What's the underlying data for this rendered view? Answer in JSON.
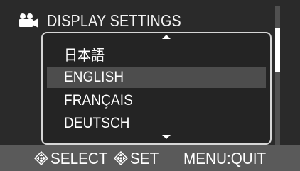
{
  "header": {
    "icon": "movie-camera-icon",
    "title": "DISPLAY SETTINGS"
  },
  "language_list": {
    "items": [
      {
        "label": "日本語",
        "selected": false
      },
      {
        "label": "ENGLISH",
        "selected": true
      },
      {
        "label": "FRANÇAIS",
        "selected": false
      },
      {
        "label": "DEUTSCH",
        "selected": false
      }
    ],
    "up_arrow_icon": "triangle-up-icon",
    "down_arrow_icon": "triangle-down-icon"
  },
  "footer": {
    "select_icon": "dpad-icon",
    "select_label": "SELECT",
    "set_icon": "dpad-icon",
    "set_label": "SET",
    "quit_label": "MENU:QUIT"
  },
  "colors": {
    "background": "#2a2a2a",
    "selected_row": "#4d4d4d",
    "footer": "#5a5a5a",
    "text": "#ffffff"
  }
}
